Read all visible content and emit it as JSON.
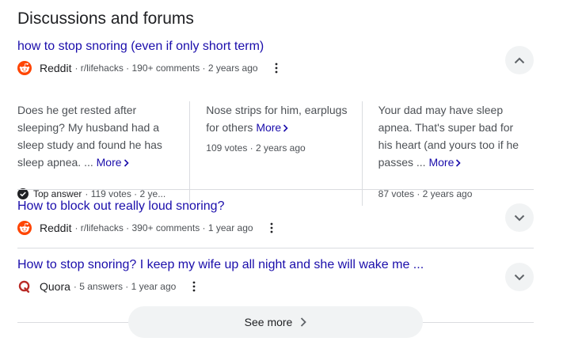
{
  "section": {
    "title": "Discussions and forums"
  },
  "results": [
    {
      "title": "how to stop snoring (even if only short term)",
      "source": "Reddit",
      "details": "· r/lifehacks · 190+ comments · 2 years ago",
      "icon": "reddit-icon",
      "expanded": true,
      "snippets": [
        {
          "text": "Does he get rested after sleeping? My husband had a sleep study and found he has sleep apnea. ...",
          "more": "More",
          "badge": "Top answer",
          "meta": "· 119 votes · 2 ye..."
        },
        {
          "text": "Nose strips for him, earplugs for others",
          "more": "More",
          "meta": "109 votes · 2 years ago"
        },
        {
          "text": "Your dad may have sleep apnea. That's super bad for his heart (and yours too if he passes ...",
          "more": "More",
          "meta": "87 votes · 2 years ago"
        }
      ]
    },
    {
      "title": "How to block out really loud snoring?",
      "source": "Reddit",
      "details": "· r/lifehacks · 390+ comments · 1 year ago",
      "icon": "reddit-icon",
      "expanded": false
    },
    {
      "title": "How to stop snoring? I keep my wife up all night and she will wake me ...",
      "source": "Quora",
      "details": "· 5 answers · 1 year ago",
      "icon": "quora-icon",
      "expanded": false
    }
  ],
  "see_more": {
    "label": "See more"
  },
  "colors": {
    "link": "#1a0dab",
    "reddit": "#ff4500",
    "quora": "#b92b27",
    "divider": "#dadce0",
    "chip": "#f1f3f4"
  }
}
